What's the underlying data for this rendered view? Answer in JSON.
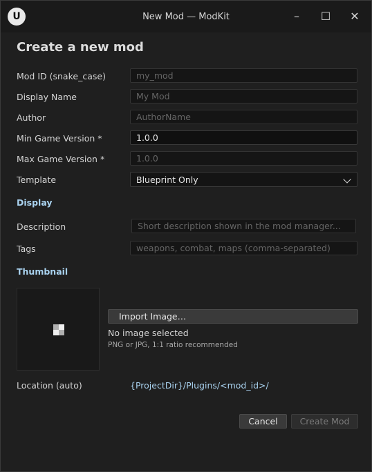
{
  "window": {
    "title": "New Mod — ModKit",
    "logo_icon": "unreal-engine-logo",
    "logo_text": "U",
    "minimize_glyph": "–",
    "maximize_glyph": "☐",
    "close_glyph": "✕"
  },
  "heading": "Create a new mod",
  "form": {
    "mod_id": {
      "label": "Mod ID (snake_case)",
      "placeholder": "my_mod"
    },
    "display_name": {
      "label": "Display Name",
      "placeholder": "My Mod"
    },
    "author": {
      "label": "Author",
      "placeholder": "AuthorName"
    },
    "min_version": {
      "label": "Min Game Version",
      "required": "*",
      "value": "1.0.0"
    },
    "max_version": {
      "label": "Max Game Version",
      "required": "*",
      "placeholder": "1.0.0"
    },
    "template": {
      "label": "Template",
      "value": "Blueprint Only"
    }
  },
  "display_section": {
    "title": "Display",
    "description": {
      "label": "Description",
      "placeholder": "Short description shown in the mod manager..."
    },
    "tags": {
      "label": "Tags",
      "placeholder": "weapons, combat, maps  (comma-separated)"
    }
  },
  "thumbnail_section": {
    "title": "Thumbnail",
    "placeholder_icon": "checkerboard-image-icon",
    "import_button": "Import Image…",
    "status": "No image selected",
    "hint": "PNG or JPG, 1:1 ratio recommended"
  },
  "location": {
    "label": "Location (auto)",
    "value": "{ProjectDir}/Plugins/<mod_id>/"
  },
  "actions": {
    "cancel": "Cancel",
    "create": "Create Mod"
  },
  "colors": {
    "accent_text": "#a9d2ef",
    "background": "#1f1f1f"
  }
}
